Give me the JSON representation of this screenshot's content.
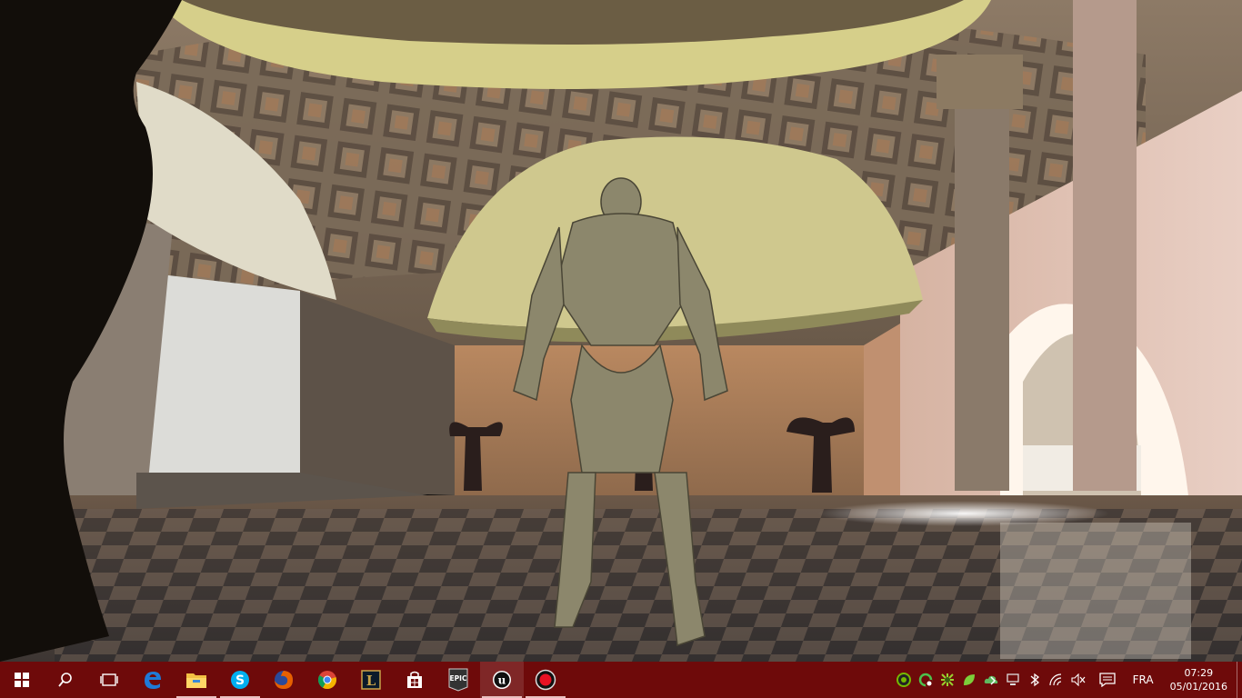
{
  "viewport": {
    "description_name": "unreal-engine-game-view"
  },
  "taskbar": {
    "background_color": "#6e0a0a",
    "start_icon": "windows-logo-icon",
    "search_icon": "search-icon",
    "task_view_icon": "task-view-icon",
    "pinned_apps": [
      {
        "icon": "edge-icon",
        "color": "#1f7ad8"
      },
      {
        "icon": "file-explorer-icon",
        "color": "#f3c043"
      },
      {
        "icon": "skype-icon",
        "color": "#00aff0"
      },
      {
        "icon": "firefox-icon",
        "color": "#e66000"
      },
      {
        "icon": "chrome-icon",
        "color": "#4285f4"
      },
      {
        "icon": "league-of-legends-icon",
        "color": "#c9a54a"
      },
      {
        "icon": "windows-store-icon",
        "color": "#ffffff"
      },
      {
        "icon": "epic-games-launcher-icon",
        "color": "#333333",
        "label": "EPIC"
      },
      {
        "icon": "unreal-engine-icon",
        "color": "#ffffff"
      },
      {
        "icon": "record-icon",
        "color": "#e81123"
      }
    ],
    "tray": {
      "icons": [
        "nvidia-green-circle-icon",
        "green-sync-icon",
        "green-gear-icon",
        "green-leaf-icon",
        "green-cloud-icon",
        "network-computer-icon",
        "bluetooth-icon",
        "wifi-icon",
        "volume-muted-icon"
      ],
      "notification_icon": "action-center-icon",
      "language": "FRA",
      "time": "07:29",
      "date": "05/01/2016"
    }
  }
}
